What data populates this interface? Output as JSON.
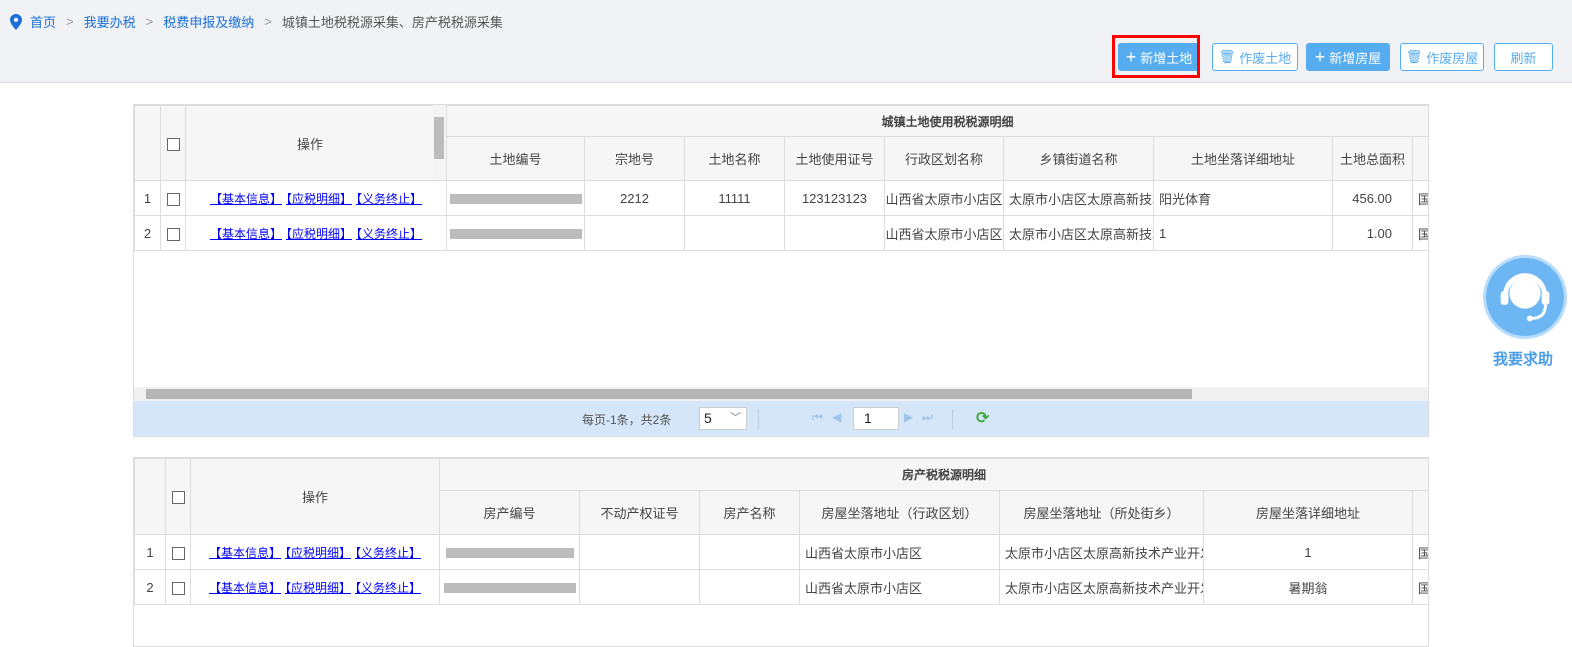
{
  "breadcrumb": {
    "items": [
      "首页",
      "我要办税",
      "税费申报及缴纳"
    ],
    "current": "城镇土地税税源采集、房产税税源采集"
  },
  "toolbar": {
    "add_land": "新增土地",
    "void_land": "作废土地",
    "add_house": "新增房屋",
    "void_house": "作废房屋",
    "refresh": "刷新"
  },
  "ops": {
    "basic": "【基本信息】",
    "detail": "【应税明细】",
    "terminate": "【义务终止】",
    "header": "操作"
  },
  "land": {
    "group_title": "城镇土地使用税税源明细",
    "columns": [
      "土地编号",
      "宗地号",
      "土地名称",
      "土地使用证号",
      "行政区划名称",
      "乡镇街道名称",
      "土地坐落详细地址",
      "土地总面积"
    ],
    "rows": [
      {
        "num": "1",
        "zdh": "2212",
        "name": "11111",
        "cert": "123123123",
        "region": "山西省太原市小店区",
        "street": "太原市小店区太原高新技术",
        "addr": "阳光体育",
        "area": "456.00",
        "next": "国"
      },
      {
        "num": "2",
        "zdh": "",
        "name": "",
        "cert": "",
        "region": "山西省太原市小店区",
        "street": "太原市小店区太原高新技术",
        "addr": "1",
        "area": "1.00",
        "next": "国"
      }
    ],
    "pager": {
      "info": "每页-1条，共2条",
      "page_size": "5",
      "page": "1"
    }
  },
  "house": {
    "group_title": "房产税税源明细",
    "columns": [
      "房产编号",
      "不动产权证号",
      "房产名称",
      "房屋坐落地址（行政区划）",
      "房屋坐落地址（所处街乡）",
      "房屋坐落详细地址"
    ],
    "rows": [
      {
        "num": "1",
        "cert": "",
        "name": "",
        "region": "山西省太原市小店区",
        "street": "太原市小店区太原高新技术产业开发区",
        "addr": "1",
        "next": "国"
      },
      {
        "num": "2",
        "cert": "",
        "name": "",
        "region": "山西省太原市小店区",
        "street": "太原市小店区太原高新技术产业开发区",
        "addr": "暑期翁",
        "next": "国"
      }
    ]
  },
  "help": {
    "label": "我要求助"
  }
}
